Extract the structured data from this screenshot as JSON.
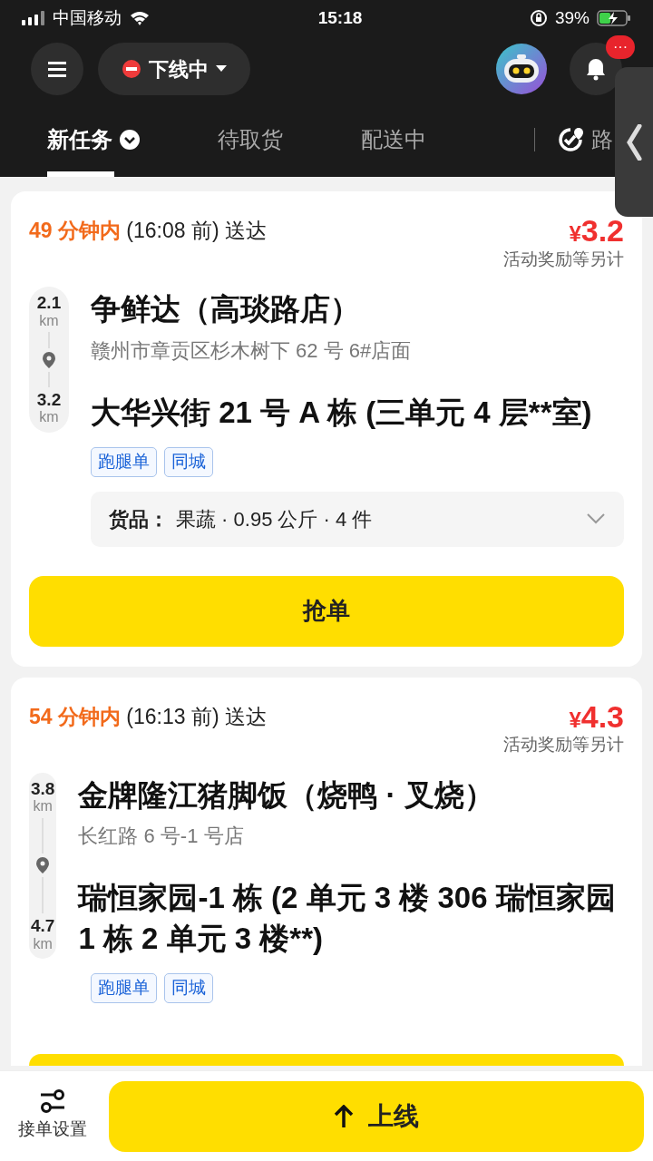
{
  "status_bar": {
    "carrier": "中国移动",
    "time": "15:18",
    "battery": "39%"
  },
  "header": {
    "status_label": "下线中",
    "notification_badge": "···"
  },
  "tabs": [
    {
      "label": "新任务",
      "selected": true,
      "kind": "dropdown"
    },
    {
      "label": "待取货",
      "selected": false,
      "kind": "plain"
    },
    {
      "label": "配送中",
      "selected": false,
      "kind": "plain"
    },
    {
      "label": "路",
      "selected": false,
      "kind": "route"
    }
  ],
  "orders": [
    {
      "time_limit": "49 分钟内",
      "deadline": "(16:08 前) 送达",
      "currency": "¥",
      "price": "3.2",
      "price_note": "活动奖励等另计",
      "pickup_distance": "2.1",
      "pickup_unit": "km",
      "dropoff_distance": "3.2",
      "dropoff_unit": "km",
      "store": "争鲜达（高琰路店）",
      "store_address": "赣州市章贡区杉木树下 62 号 6#店面",
      "destination": "大华兴街 21 号 A 栋 (三单元 4 层**室)",
      "tags": [
        "跑腿单",
        "同城"
      ],
      "goods": {
        "label": "货品：",
        "detail": "果蔬 · 0.95 公斤 · 4 件"
      },
      "button": "抢单"
    },
    {
      "time_limit": "54 分钟内",
      "deadline": "(16:13 前) 送达",
      "currency": "¥",
      "price": "4.3",
      "price_note": "活动奖励等另计",
      "pickup_distance": "3.8",
      "pickup_unit": "km",
      "dropoff_distance": "4.7",
      "dropoff_unit": "km",
      "store": "金牌隆江猪脚饭（烧鸭 · 叉烧）",
      "store_address": "长红路 6 号-1 号店",
      "destination": "瑞恒家园-1 栋 (2 单元 3 楼 306 瑞恒家园 1 栋 2 单元 3 楼**)",
      "tags": [
        "跑腿单",
        "同城"
      ]
    }
  ],
  "bottom_bar": {
    "settings_label": "接单设置",
    "online_button": "上线"
  }
}
